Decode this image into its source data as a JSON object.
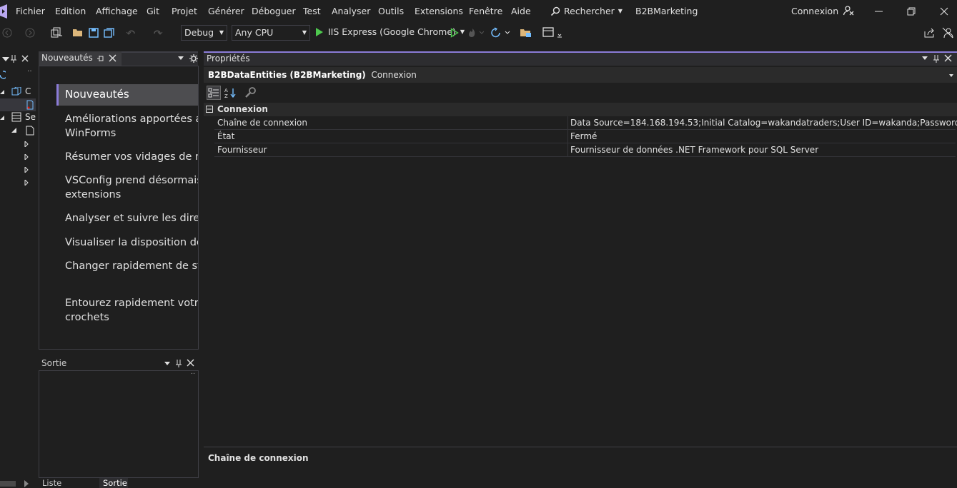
{
  "menu": [
    "Fichier",
    "Edition",
    "Affichage",
    "Git",
    "Projet",
    "Générer",
    "Déboguer",
    "Test",
    "Analyser",
    "Outils",
    "Extensions",
    "Fenêtre",
    "Aide"
  ],
  "search_label": "Rechercher",
  "solution_name": "B2BMarketing",
  "account_label": "Connexion",
  "toolbar": {
    "config": "Debug",
    "platform": "Any CPU",
    "run_target": "IIS Express (Google Chrome)"
  },
  "left_strip": {
    "labels": [
      "C",
      "Se"
    ]
  },
  "news_panel": {
    "tab_label": "Nouveautés",
    "selected": "Nouveautés",
    "items": [
      [
        "Améliorations apportées au",
        "WinForms"
      ],
      [
        "Résumer vos vidages de mém"
      ],
      [
        "VSConfig prend désormais e",
        "extensions"
      ],
      [
        "Analyser et suivre les directiv"
      ],
      [
        "Visualiser la disposition de la"
      ],
      [
        "Changer rapidement de style"
      ],
      [
        "Entourez rapidement votre c",
        "crochets"
      ]
    ]
  },
  "output_panel": {
    "title": "Sortie",
    "tabs": [
      "Liste d'erreurs",
      "Sortie"
    ]
  },
  "properties": {
    "title": "Propriétés",
    "object_name": "B2BDataEntities (B2BMarketing)",
    "object_type": "Connexion",
    "category": "Connexion",
    "rows": [
      {
        "name": "Chaîne de connexion",
        "value": "Data Source=184.168.194.53;Initial Catalog=wakandatraders;User ID=wakanda;Password=***********"
      },
      {
        "name": "État",
        "value": "Fermé"
      },
      {
        "name": "Fournisseur",
        "value": "Fournisseur de données .NET Framework pour SQL Server"
      }
    ],
    "description_title": "Chaîne de connexion"
  },
  "colors": {
    "accent": "#8b7cd8",
    "background": "#1f1f1f",
    "run_green": "#4ec94e"
  }
}
